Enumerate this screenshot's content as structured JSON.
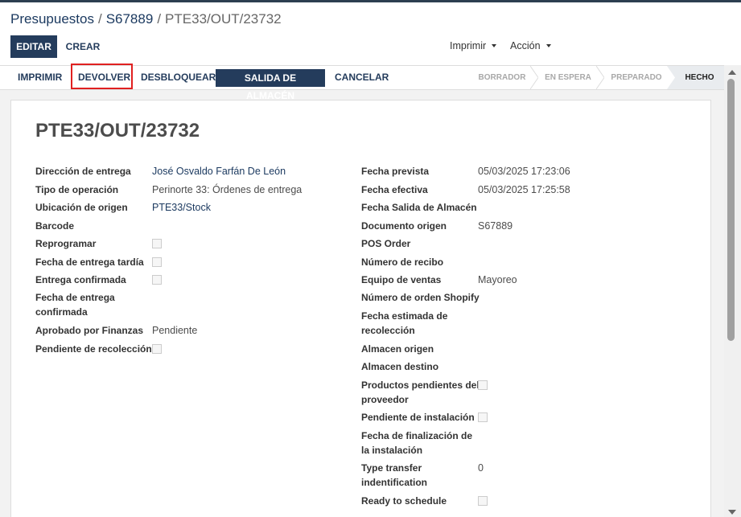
{
  "breadcrumb": {
    "items": [
      "Presupuestos",
      "S67889"
    ],
    "current": "PTE33/OUT/23732",
    "separator": "/"
  },
  "control": {
    "edit_label": "EDITAR",
    "create_label": "CREAR",
    "print_label": "Imprimir",
    "action_label": "Acción"
  },
  "statusbar": {
    "buttons": {
      "print": "IMPRIMIR",
      "return": "DEVOLVER",
      "unlock": "DESBLOQUEAR",
      "warehouse_out": "SALIDA DE ALMACÉN",
      "cancel": "CANCELAR"
    },
    "stages": [
      "BORRADOR",
      "EN ESPERA",
      "PREPARADO",
      "HECHO"
    ],
    "current_stage": "HECHO"
  },
  "record": {
    "title": "PTE33/OUT/23732",
    "left": {
      "delivery_address": {
        "label": "Dirección de entrega",
        "value": "José Osvaldo Farfán De León"
      },
      "operation_type": {
        "label": "Tipo de operación",
        "value": "Perinorte 33: Órdenes de entrega"
      },
      "source_location": {
        "label": "Ubicación de origen",
        "value": "PTE33/Stock"
      },
      "barcode": {
        "label": "Barcode"
      },
      "reschedule": {
        "label": "Reprogramar",
        "checked": false
      },
      "late_delivery": {
        "label": "Fecha de entrega tardía",
        "checked": false
      },
      "delivery_confirmed": {
        "label": "Entrega confirmada",
        "checked": false
      },
      "confirmed_date": {
        "label_line1": "Fecha de entrega",
        "label_line2": "confirmada"
      },
      "finance_approved": {
        "label": "Aprobado por Finanzas",
        "value": "Pendiente"
      },
      "pickup_pending": {
        "label": "Pendiente de recolección",
        "checked": false
      }
    },
    "right": {
      "scheduled_date": {
        "label": "Fecha prevista",
        "value": "05/03/2025 17:23:06"
      },
      "effective_date": {
        "label": "Fecha efectiva",
        "value": "05/03/2025 17:25:58"
      },
      "warehouse_out_date": {
        "label": "Fecha Salida de Almacén"
      },
      "source_document": {
        "label": "Documento origen",
        "value": "S67889"
      },
      "pos_order": {
        "label": "POS Order"
      },
      "receipt_number": {
        "label": "Número de recibo"
      },
      "sales_team": {
        "label": "Equipo de ventas",
        "value": "Mayoreo"
      },
      "shopify_order": {
        "label": "Número de orden Shopify"
      },
      "pickup_estimate": {
        "label_line1": "Fecha estimada de",
        "label_line2": "recolección"
      },
      "source_warehouse": {
        "label": "Almacen origen"
      },
      "dest_warehouse": {
        "label": "Almacen destino"
      },
      "supplier_pending": {
        "label_line1": "Productos pendientes del",
        "label_line2": "proveedor",
        "checked": false
      },
      "install_pending": {
        "label": "Pendiente de instalación",
        "checked": false
      },
      "install_end": {
        "label_line1": "Fecha de finalización de",
        "label_line2": "la instalación"
      },
      "transfer_type": {
        "label_line1": "Type transfer",
        "label_line2": "indentification",
        "value": "0"
      },
      "ready_to_schedule": {
        "label": "Ready to schedule",
        "checked": false
      }
    }
  },
  "colors": {
    "primary": "#243c5c",
    "highlight": "#e02020"
  }
}
